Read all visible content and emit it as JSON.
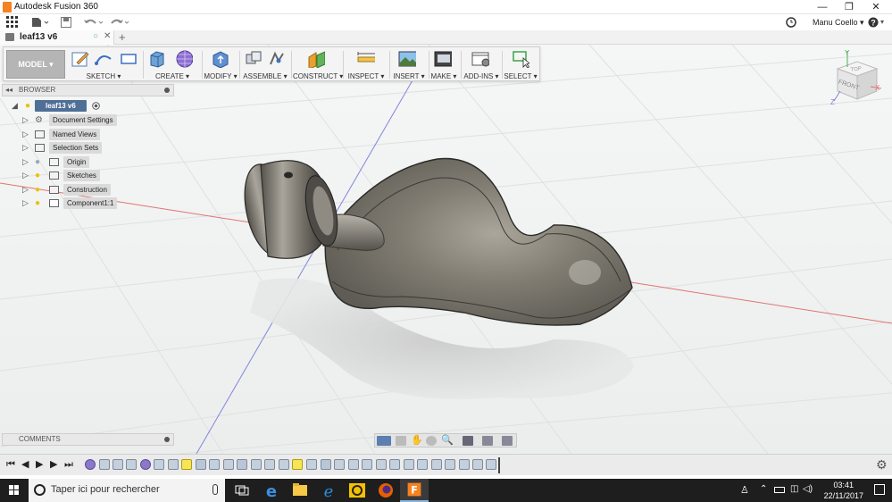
{
  "window": {
    "app_title": "Autodesk Fusion 360",
    "minimize": "—",
    "maximize": "❐",
    "close": "✕"
  },
  "quick_access": {
    "user_name": "Manu Coello",
    "help": "?"
  },
  "document_tab": {
    "name": "leaf13 v6",
    "close": "✕",
    "new_tab": "+"
  },
  "toolbar": {
    "workspace": "MODEL",
    "groups": [
      {
        "label": "SKETCH"
      },
      {
        "label": "CREATE"
      },
      {
        "label": "MODIFY"
      },
      {
        "label": "ASSEMBLE"
      },
      {
        "label": "CONSTRUCT"
      },
      {
        "label": "INSPECT"
      },
      {
        "label": "INSERT"
      },
      {
        "label": "MAKE"
      },
      {
        "label": "ADD-INS"
      },
      {
        "label": "SELECT"
      }
    ]
  },
  "browser": {
    "title": "BROWSER",
    "root": "leaf13 v6",
    "items": [
      {
        "label": "Document Settings",
        "icon": "gear-icon",
        "bulb": false
      },
      {
        "label": "Named Views",
        "icon": "folder-icon",
        "bulb": false
      },
      {
        "label": "Selection Sets",
        "icon": "folder-icon",
        "bulb": false
      },
      {
        "label": "Origin",
        "icon": "folder-icon",
        "bulb": true
      },
      {
        "label": "Sketches",
        "icon": "folder-icon",
        "bulb": true
      },
      {
        "label": "Construction",
        "icon": "folder-icon",
        "bulb": true
      },
      {
        "label": "Component1:1",
        "icon": "component-icon",
        "bulb": true
      }
    ]
  },
  "viewcube": {
    "top": "TOP",
    "front": "FRONT",
    "axis_x": "X",
    "axis_y": "Y",
    "axis_z": "Z"
  },
  "comments": {
    "title": "COMMENTS"
  },
  "taskbar": {
    "search_placeholder": "Taper ici pour rechercher",
    "time": "03:41",
    "date": "22/11/2017"
  },
  "colors": {
    "accent": "#f58220",
    "axis_red": "#e0746f",
    "axis_blue": "#7f86d9",
    "model_gray": "#7a776f"
  }
}
